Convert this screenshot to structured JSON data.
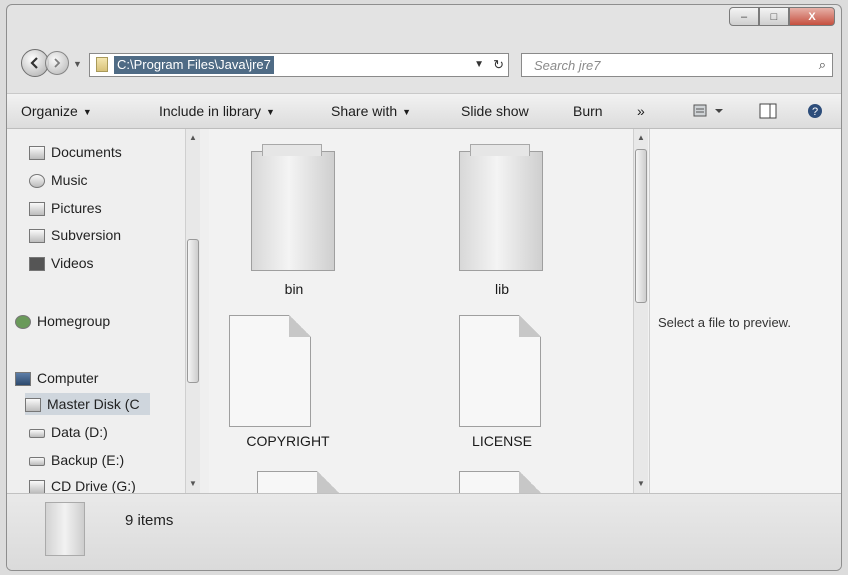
{
  "window": {
    "caption": {
      "minimize": "–",
      "maximize": "□",
      "close": "X"
    }
  },
  "address": {
    "path": "C:\\Program Files\\Java\\jre7",
    "search_placeholder": "Search jre7"
  },
  "toolbar": {
    "organize": "Organize",
    "include_in_library": "Include in library",
    "share_with": "Share with",
    "slide_show": "Slide show",
    "burn": "Burn",
    "more": "»"
  },
  "nav": {
    "items": [
      {
        "label": "Documents",
        "icon": "documents-icon"
      },
      {
        "label": "Music",
        "icon": "music-icon"
      },
      {
        "label": "Pictures",
        "icon": "pictures-icon"
      },
      {
        "label": "Subversion",
        "icon": "subversion-icon"
      },
      {
        "label": "Videos",
        "icon": "videos-icon"
      },
      {
        "label": "Homegroup",
        "icon": "homegroup-icon"
      },
      {
        "label": "Computer",
        "icon": "computer-icon"
      },
      {
        "label": "Master Disk (C",
        "icon": "drive-c-icon",
        "selected": true
      },
      {
        "label": "Data (D:)",
        "icon": "drive-icon"
      },
      {
        "label": "Backup (E:)",
        "icon": "drive-icon"
      },
      {
        "label": "CD Drive (G:)",
        "icon": "cd-drive-icon"
      }
    ]
  },
  "files": [
    {
      "name": "bin",
      "type": "folder"
    },
    {
      "name": "lib",
      "type": "folder"
    },
    {
      "name": "COPYRIGHT",
      "type": "file"
    },
    {
      "name": "LICENSE",
      "type": "file"
    }
  ],
  "preview": {
    "text": "Select a file to preview."
  },
  "details": {
    "count": "9 items"
  }
}
